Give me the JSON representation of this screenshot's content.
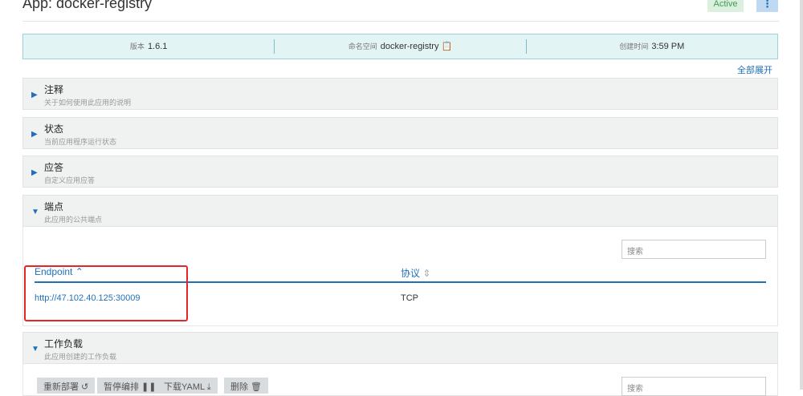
{
  "header": {
    "title": "App: docker-registry",
    "status": "Active",
    "menu_icon": "⋮"
  },
  "info": {
    "version_label": "版本",
    "version": "1.6.1",
    "namespace_label": "命名空间",
    "namespace": "docker-registry",
    "created_label": "创建时间",
    "created": "3:59 PM"
  },
  "expand_all": "全部展开",
  "sections": [
    {
      "title": "注释",
      "desc": "关于如何使用此应用的说明",
      "expanded": false
    },
    {
      "title": "状态",
      "desc": "当前应用程序运行状态",
      "expanded": false
    },
    {
      "title": "应答",
      "desc": "自定义应用应答",
      "expanded": false
    },
    {
      "title": "端点",
      "desc": "此应用的公共端点",
      "expanded": true
    },
    {
      "title": "工作负载",
      "desc": "此应用创建的工作负载",
      "expanded": true
    }
  ],
  "endpoints": {
    "search_placeholder": "搜索",
    "columns": [
      "Endpoint",
      "协议"
    ],
    "rows": [
      {
        "endpoint": "http://47.102.40.125:30009",
        "protocol": "TCP"
      }
    ]
  },
  "workloads": {
    "search_placeholder": "搜索",
    "buttons": [
      "重新部署 ↺",
      "暂停编排 ❚❚",
      "下载YAML ⤓",
      "删除 🗑"
    ]
  }
}
